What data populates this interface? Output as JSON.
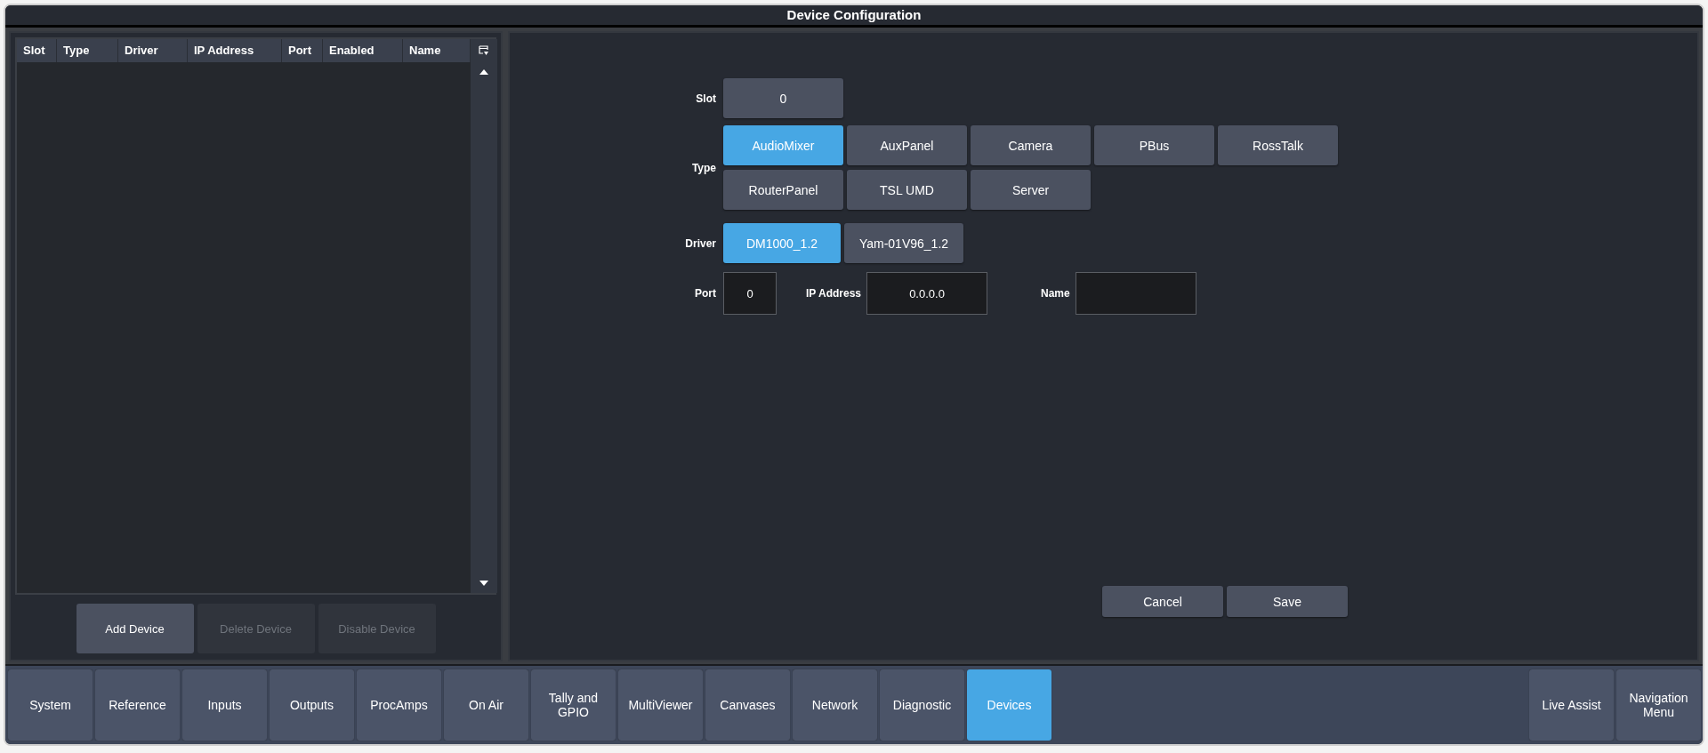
{
  "window": {
    "title": "Device Configuration"
  },
  "device_table": {
    "columns": [
      "Slot",
      "Type",
      "Driver",
      "IP Address",
      "Port",
      "Enabled",
      "Name"
    ]
  },
  "table_buttons": [
    {
      "label": "Add Device",
      "disabled": false
    },
    {
      "label": "Delete Device",
      "disabled": true
    },
    {
      "label": "Disable Device",
      "disabled": true
    }
  ],
  "form": {
    "slot": {
      "label": "Slot",
      "value": "0"
    },
    "type": {
      "label": "Type",
      "options": [
        {
          "label": "AudioMixer",
          "selected": true
        },
        {
          "label": "AuxPanel",
          "selected": false
        },
        {
          "label": "Camera",
          "selected": false
        },
        {
          "label": "PBus",
          "selected": false
        },
        {
          "label": "RossTalk",
          "selected": false
        },
        {
          "label": "RouterPanel",
          "selected": false
        },
        {
          "label": "TSL UMD",
          "selected": false
        },
        {
          "label": "Server",
          "selected": false
        }
      ]
    },
    "driver": {
      "label": "Driver",
      "options": [
        {
          "label": "DM1000_1.2",
          "selected": true
        },
        {
          "label": "Yam-01V96_1.2",
          "selected": false
        }
      ]
    },
    "port": {
      "label": "Port",
      "value": "0"
    },
    "ip_address": {
      "label": "IP Address",
      "value": "0.0.0.0"
    },
    "name": {
      "label": "Name"
    }
  },
  "form_buttons": [
    "Cancel",
    "Save"
  ],
  "nav_tabs": [
    {
      "label": "System",
      "selected": false
    },
    {
      "label": "Reference",
      "selected": false
    },
    {
      "label": "Inputs",
      "selected": false
    },
    {
      "label": "Outputs",
      "selected": false
    },
    {
      "label": "ProcAmps",
      "selected": false
    },
    {
      "label": "On Air",
      "selected": false
    },
    {
      "label": "Tally and GPIO",
      "selected": false
    },
    {
      "label": "MultiViewer",
      "selected": false
    },
    {
      "label": "Canvases",
      "selected": false
    },
    {
      "label": "Network",
      "selected": false
    },
    {
      "label": "Diagnostic",
      "selected": false
    },
    {
      "label": "Devices",
      "selected": true
    }
  ],
  "nav_right": [
    "Live Assist",
    "Navigation Menu"
  ]
}
